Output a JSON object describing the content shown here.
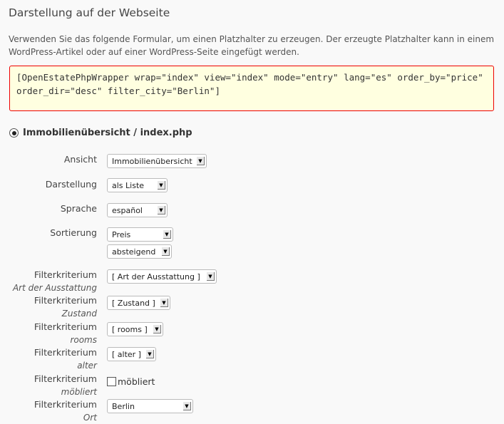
{
  "title": "Darstellung auf der Webseite",
  "intro": "Verwenden Sie das folgende Formular, um einen Platzhalter zu erzeugen. Der erzeugte Platzhalter kann in einem WordPress-Artikel oder auf einer WordPress-Seite eingefügt werden.",
  "shortcode": "[OpenEstatePhpWrapper wrap=\"index\" view=\"index\" mode=\"entry\" lang=\"es\" order_by=\"price\" order_dir=\"desc\" filter_city=\"Berlin\"]",
  "colors": {
    "code_border": "#e00000",
    "code_bg": "#ffffe0"
  },
  "section": {
    "label": "Immobilienübersicht / index.php",
    "selected": true
  },
  "fields": {
    "ansicht": {
      "label": "Ansicht",
      "value": "Immobilienübersicht"
    },
    "darstellung": {
      "label": "Darstellung",
      "value": "als Liste"
    },
    "sprache": {
      "label": "Sprache",
      "value": "español"
    },
    "sortierung": {
      "label": "Sortierung",
      "value": "Preis",
      "dir": "absteigend"
    },
    "filters": [
      {
        "label": "Filterkriterium",
        "sub": "Art der Ausstattung",
        "value": "[ Art der Ausstattung ]"
      },
      {
        "label": "Filterkriterium",
        "sub": "Zustand",
        "value": "[ Zustand ]"
      },
      {
        "label": "Filterkriterium",
        "sub": "rooms",
        "value": "[ rooms ]"
      },
      {
        "label": "Filterkriterium",
        "sub": "alter",
        "value": "[ alter ]"
      },
      {
        "label": "Filterkriterium",
        "sub": "möbliert",
        "checkbox": "möbliert",
        "checked": false
      },
      {
        "label": "Filterkriterium",
        "sub": "Ort",
        "value": "Berlin"
      }
    ]
  }
}
